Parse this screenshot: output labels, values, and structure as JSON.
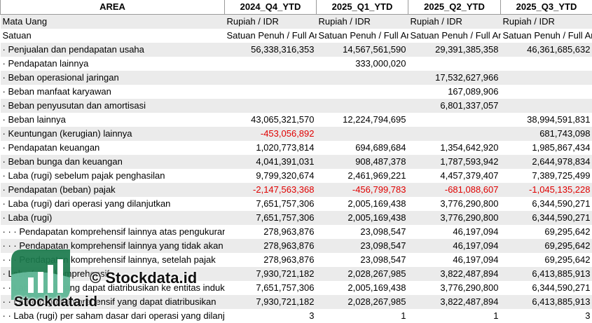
{
  "header": [
    "AREA",
    "2024_Q4_YTD",
    "2025_Q1_YTD",
    "2025_Q2_YTD",
    "2025_Q3_YTD"
  ],
  "rows": [
    {
      "label": "Mata Uang",
      "values": [
        "Rupiah / IDR",
        "Rupiah / IDR",
        "Rupiah / IDR",
        "Rupiah / IDR"
      ],
      "kind": "text"
    },
    {
      "label": "Satuan",
      "values": [
        "Satuan Penuh / Full Amount",
        "Satuan Penuh / Full Amount",
        "Satuan Penuh / Full Amount",
        "Satuan Penuh / Full Amount"
      ],
      "kind": "text"
    },
    {
      "label": "· Penjualan dan pendapatan usaha",
      "values": [
        "56,338,316,353",
        "14,567,561,590",
        "29,391,385,358",
        "46,361,685,632"
      ]
    },
    {
      "label": "· Pendapatan lainnya",
      "values": [
        "",
        "333,000,020",
        "",
        ""
      ]
    },
    {
      "label": "· Beban operasional jaringan",
      "values": [
        "",
        "",
        "17,532,627,966",
        ""
      ]
    },
    {
      "label": "· Beban manfaat karyawan",
      "values": [
        "",
        "",
        "167,089,906",
        ""
      ]
    },
    {
      "label": "· Beban penyusutan dan amortisasi",
      "values": [
        "",
        "",
        "6,801,337,057",
        ""
      ]
    },
    {
      "label": "· Beban lainnya",
      "values": [
        "43,065,321,570",
        "12,224,794,695",
        "",
        "38,994,591,831"
      ]
    },
    {
      "label": "· Keuntungan (kerugian) lainnya",
      "values": [
        "-453,056,892",
        "",
        "",
        "681,743,098"
      ]
    },
    {
      "label": "· Pendapatan keuangan",
      "values": [
        "1,020,773,814",
        "694,689,684",
        "1,354,642,920",
        "1,985,867,434"
      ]
    },
    {
      "label": "· Beban bunga dan keuangan",
      "values": [
        "4,041,391,031",
        "908,487,378",
        "1,787,593,942",
        "2,644,978,834"
      ]
    },
    {
      "label": "· Laba (rugi) sebelum pajak penghasilan",
      "values": [
        "9,799,320,674",
        "2,461,969,221",
        "4,457,379,407",
        "7,389,725,499"
      ]
    },
    {
      "label": "· Pendapatan (beban) pajak",
      "values": [
        "-2,147,563,368",
        "-456,799,783",
        "-681,088,607",
        "-1,045,135,228"
      ]
    },
    {
      "label": "· Laba (rugi) dari operasi yang dilanjutkan",
      "values": [
        "7,651,757,306",
        "2,005,169,438",
        "3,776,290,800",
        "6,344,590,271"
      ]
    },
    {
      "label": "· Laba (rugi)",
      "values": [
        "7,651,757,306",
        "2,005,169,438",
        "3,776,290,800",
        "6,344,590,271"
      ]
    },
    {
      "label": "· · · Pendapatan komprehensif lainnya atas pengukuran kembali",
      "values": [
        "278,963,876",
        "23,098,547",
        "46,197,094",
        "69,295,642"
      ]
    },
    {
      "label": "· · · Pendapatan komprehensif lainnya yang tidak akan direklasifikasi",
      "values": [
        "278,963,876",
        "23,098,547",
        "46,197,094",
        "69,295,642"
      ]
    },
    {
      "label": "· · · Pendapatan komprehensif lainnya, setelah pajak",
      "values": [
        "278,963,876",
        "23,098,547",
        "46,197,094",
        "69,295,642"
      ]
    },
    {
      "label": "· Laba (rugi) komprehensif",
      "values": [
        "7,930,721,182",
        "2,028,267,985",
        "3,822,487,894",
        "6,413,885,913"
      ]
    },
    {
      "label": "· · Laba (rugi) yang dapat diatribusikan ke entitas induk",
      "values": [
        "7,651,757,306",
        "2,005,169,438",
        "3,776,290,800",
        "6,344,590,271"
      ]
    },
    {
      "label": "· · Laba (rugi) komprehensif yang dapat diatribusikan",
      "values": [
        "7,930,721,182",
        "2,028,267,985",
        "3,822,487,894",
        "6,413,885,913"
      ]
    },
    {
      "label": "· · Laba (rugi) per saham dasar dari operasi yang dilanjutkan",
      "values": [
        "3",
        "1",
        "1",
        "3"
      ]
    }
  ],
  "watermark": {
    "copyright": "© Stockdata.id",
    "site": "Stockdata.id"
  },
  "colors": {
    "negative": "#e00000",
    "stripe": "#ebebeb",
    "logo_green": "#1a7a4c"
  }
}
